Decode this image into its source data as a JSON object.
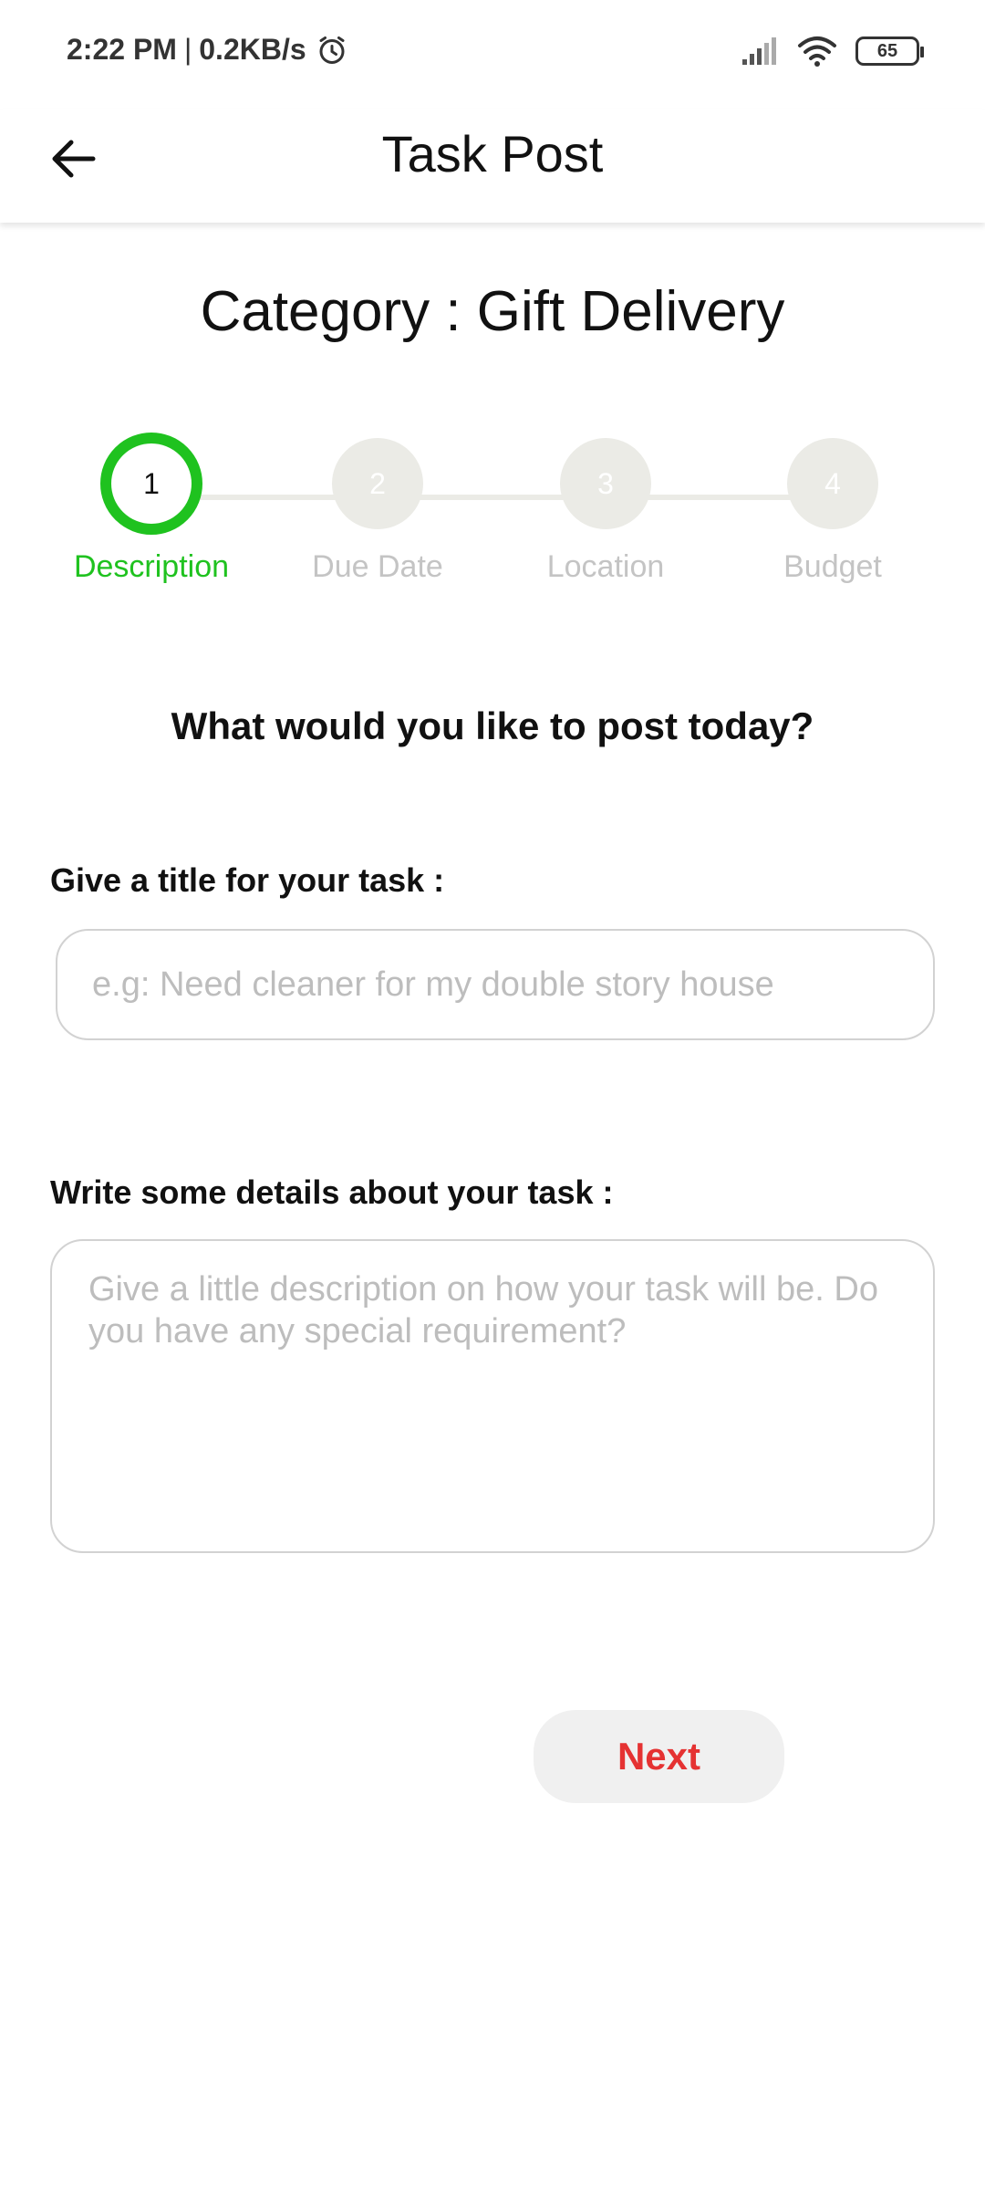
{
  "status_bar": {
    "time": "2:22 PM",
    "separator": "|",
    "network_speed": "0.2KB/s",
    "battery_level": "65",
    "icons": [
      "alarm-icon",
      "signal-icon",
      "wifi-icon",
      "battery-icon"
    ]
  },
  "app_bar": {
    "back_icon": "arrow-left-icon",
    "title": "Task Post"
  },
  "category": {
    "text": "Category : Gift Delivery"
  },
  "stepper": {
    "active_step": 1,
    "steps": [
      {
        "number": "1",
        "label": "Description"
      },
      {
        "number": "2",
        "label": "Due Date"
      },
      {
        "number": "3",
        "label": "Location"
      },
      {
        "number": "4",
        "label": "Budget"
      }
    ]
  },
  "form": {
    "question": "What would you like to post today?",
    "title_label": "Give a title for your task :",
    "title_value": "",
    "title_placeholder": "e.g: Need cleaner for my double story house",
    "details_label": "Write some details about your task :",
    "details_value": "",
    "details_placeholder": "Give a little description on how your task will be. Do you have any special requirement?"
  },
  "actions": {
    "next_label": "Next"
  },
  "colors": {
    "accent_green": "#1fc21f",
    "inactive_step": "#ebebe6",
    "next_text": "#e53232",
    "next_background": "#f0f0f0"
  }
}
